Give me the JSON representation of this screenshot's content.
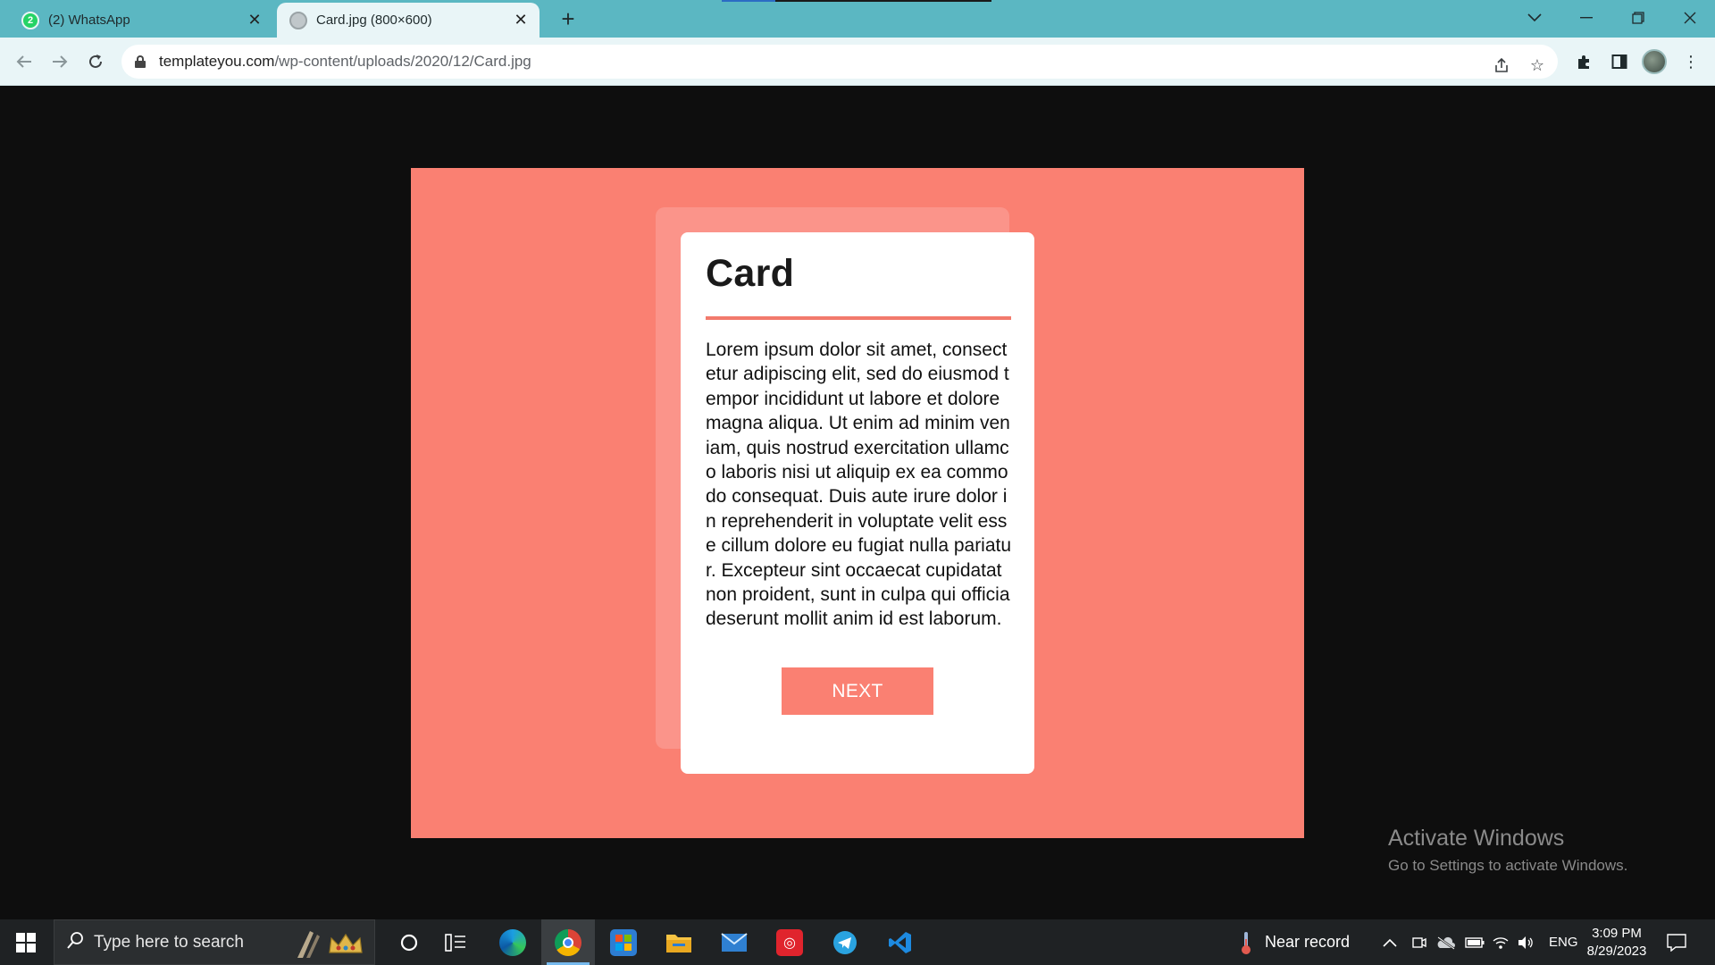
{
  "browser": {
    "tabs": [
      {
        "title": "(2) WhatsApp",
        "favicon": "whatsapp-icon",
        "badge": "2",
        "active": false
      },
      {
        "title": "Card.jpg (800×600)",
        "favicon": "globe-icon",
        "active": true
      }
    ],
    "address": {
      "domain": "templateyou.com",
      "path": "/wp-content/uploads/2020/12/Card.jpg"
    }
  },
  "image": {
    "card_title": "Card",
    "card_body": "Lorem ipsum dolor sit amet, consectetur adipiscing elit, sed do eiusmod tempor incididunt ut labore et dolore magna aliqua. Ut enim ad minim veniam, quis nostrud exercitation ullamco laboris nisi ut aliquip ex ea commodo consequat. Duis aute irure dolor in reprehenderit in voluptate velit esse cillum dolore eu fugiat nulla pariatur. Excepteur sint occaecat cupidatat non proident, sunt in culpa qui officia deserunt mollit anim id est laborum.",
    "button_label": "NEXT",
    "colors": {
      "background": "#fa8072",
      "card": "#ffffff",
      "back_card": "#fb948a",
      "accent_rule": "#f27a6c"
    }
  },
  "watermark": {
    "line1": "Activate Windows",
    "line2": "Go to Settings to activate Windows."
  },
  "taskbar": {
    "search_placeholder": "Type here to search",
    "weather_text": "Near record",
    "language": "ENG",
    "time": "3:09 PM",
    "date": "8/29/2023",
    "pinned_icons": [
      "cortana-icon",
      "task-view-icon",
      "edge-icon",
      "chrome-icon",
      "store-icon",
      "file-explorer-icon",
      "mail-icon",
      "app-red-icon",
      "telegram-icon",
      "vscode-icon"
    ]
  }
}
